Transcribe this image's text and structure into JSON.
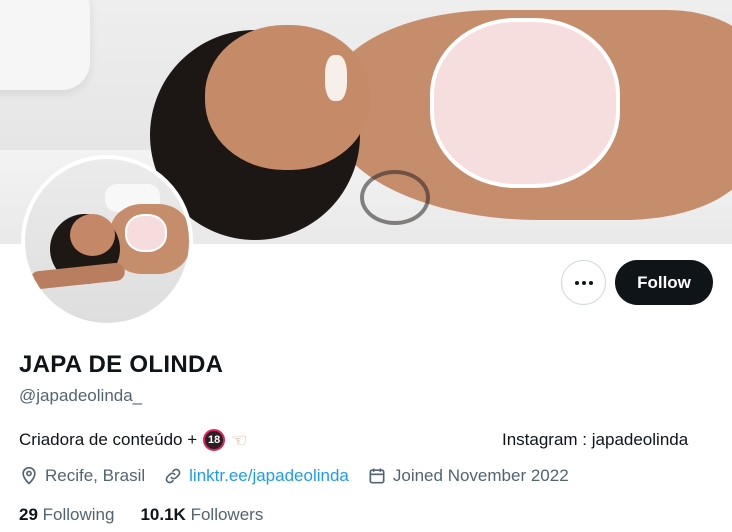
{
  "profile": {
    "display_name": "JAPA DE OLINDA",
    "handle": "@japadeolinda_",
    "bio_text": "Criadora de conteúdo +",
    "bio_badge": "18",
    "bio_right": "Instagram : japadeolinda",
    "location": "Recife, Brasil",
    "link": "linktr.ee/japadeolinda",
    "joined": "Joined November 2022",
    "following_count": "29",
    "following_label": "Following",
    "followers_count": "10.1K",
    "followers_label": "Followers"
  },
  "actions": {
    "more_icon": "more-dots-icon",
    "follow_label": "Follow"
  },
  "icons": {
    "location": "location-pin-icon",
    "link": "link-icon",
    "calendar": "calendar-icon",
    "pointer": "pointing-hand-emoji"
  },
  "colors": {
    "text_primary": "#0f1419",
    "text_secondary": "#536471",
    "link": "#1d9bf0",
    "follow_bg": "#0f1419",
    "follow_text": "#ffffff"
  }
}
